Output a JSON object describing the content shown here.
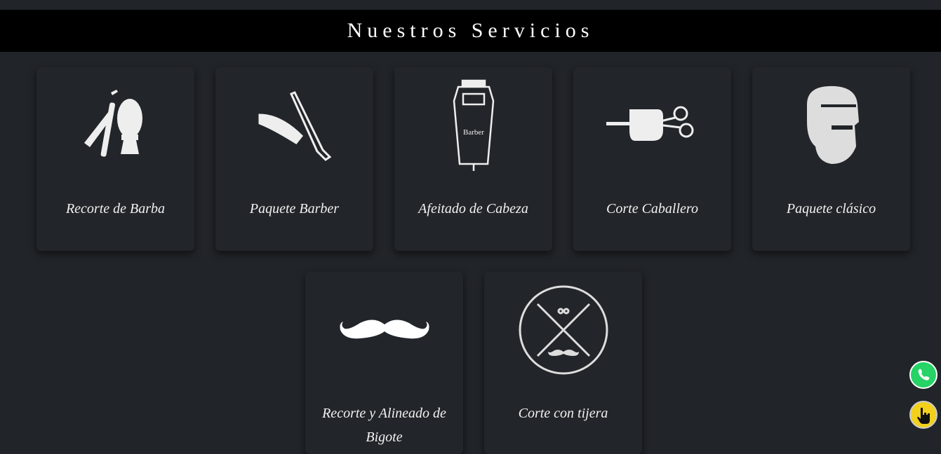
{
  "header": {
    "title": "Nuestros Servicios"
  },
  "services": [
    {
      "label": "Recorte de Barba",
      "icon": "razor-brush-icon"
    },
    {
      "label": "Paquete Barber",
      "icon": "straight-razor-icon"
    },
    {
      "label": "Afeitado de Cabeza",
      "icon": "hair-clipper-icon",
      "icon_text": "Barber"
    },
    {
      "label": "Corte Caballero",
      "icon": "fist-scissors-icon"
    },
    {
      "label": "Paquete clásico",
      "icon": "bearded-man-icon"
    },
    {
      "label": "Recorte y Alineado de Bigote",
      "icon": "mustache-icon"
    },
    {
      "label": "Corte con tijera",
      "icon": "scissors-circle-icon"
    }
  ],
  "floating": {
    "whatsapp": "whatsapp-icon",
    "touch": "touch-hand-icon"
  },
  "colors": {
    "background": "#212428",
    "header": "#000000",
    "whatsapp": "#25d366",
    "touch": "#f2d01c"
  }
}
